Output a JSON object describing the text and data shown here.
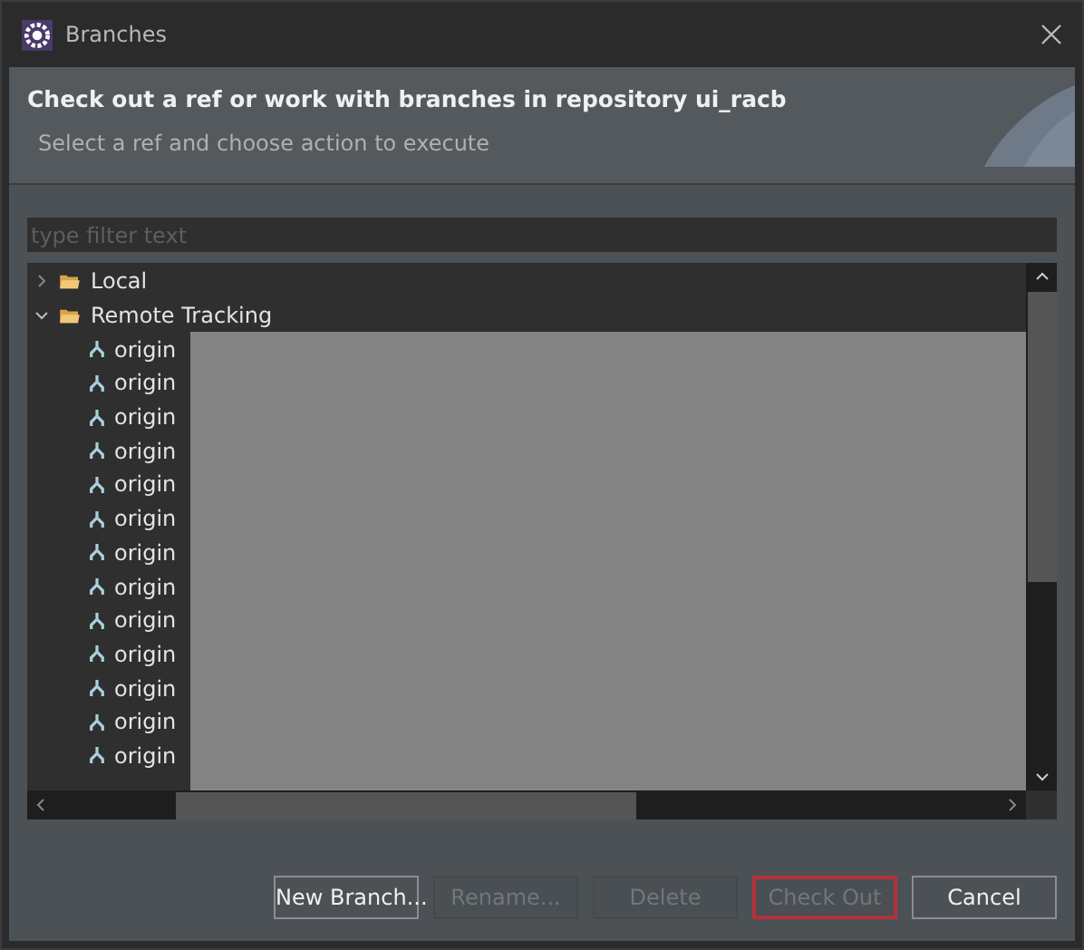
{
  "window": {
    "title": "Branches"
  },
  "header": {
    "title": "Check out a ref or work with branches in repository ui_racb",
    "subtitle": "Select a ref and choose action to execute"
  },
  "filter": {
    "placeholder": "type filter text"
  },
  "tree": [
    {
      "label": "Local",
      "expanded": false
    },
    {
      "label": "Remote Tracking",
      "expanded": true,
      "children": [
        {
          "label": "origin"
        },
        {
          "label": "origin"
        },
        {
          "label": "origin"
        },
        {
          "label": "origin"
        },
        {
          "label": "origin"
        },
        {
          "label": "origin"
        },
        {
          "label": "origin"
        },
        {
          "label": "origin"
        },
        {
          "label": "origin"
        },
        {
          "label": "origin"
        },
        {
          "label": "origin"
        },
        {
          "label": "origin"
        },
        {
          "label": "origin"
        }
      ]
    }
  ],
  "buttons": [
    {
      "label": "New Branch...",
      "disabled": false,
      "focused": false
    },
    {
      "label": "Rename...",
      "disabled": true,
      "focused": false
    },
    {
      "label": "Delete",
      "disabled": true,
      "focused": false
    },
    {
      "label": "Check Out",
      "disabled": true,
      "focused": true
    },
    {
      "label": "Cancel",
      "disabled": false,
      "focused": false
    }
  ]
}
